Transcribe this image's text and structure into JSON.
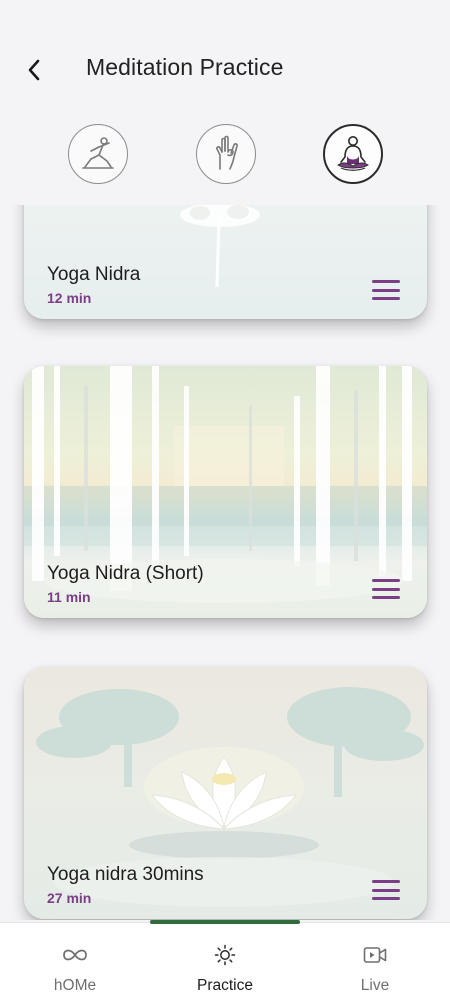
{
  "header": {
    "title": "Meditation Practice"
  },
  "categories": [
    {
      "name": "asana-icon",
      "active": false
    },
    {
      "name": "mudra-icon",
      "active": false
    },
    {
      "name": "meditation-icon",
      "active": true
    }
  ],
  "sessions": [
    {
      "title": "Yoga Nidra",
      "duration": "12 min"
    },
    {
      "title": "Yoga Nidra (Short)",
      "duration": "11 min"
    },
    {
      "title": "Yoga nidra 30mins",
      "duration": "27 min"
    }
  ],
  "colors": {
    "accent": "#7b3f86",
    "indicator": "#2f6b3b"
  },
  "bottom_nav": {
    "items": [
      {
        "label": "hOMe",
        "icon": "infinity-icon"
      },
      {
        "label": "Practice",
        "icon": "sun-icon"
      },
      {
        "label": "Live",
        "icon": "video-icon"
      }
    ],
    "active": "Practice"
  }
}
